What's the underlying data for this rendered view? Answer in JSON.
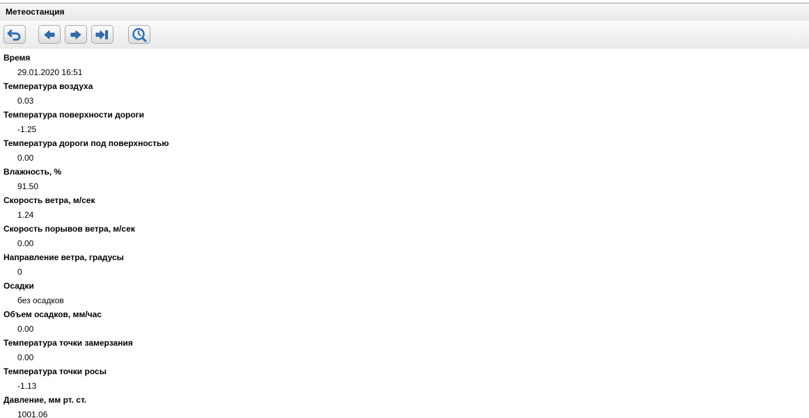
{
  "window": {
    "title": "Метеостанция"
  },
  "toolbar": {
    "buttons": [
      {
        "name": "undo",
        "icon": "undo-arrow-icon"
      },
      {
        "name": "previous",
        "icon": "arrow-left-icon"
      },
      {
        "name": "next",
        "icon": "arrow-right-icon"
      },
      {
        "name": "last",
        "icon": "arrow-to-end-icon"
      },
      {
        "name": "history",
        "icon": "clock-magnifier-icon"
      }
    ],
    "icon_color": "#2f6eb5"
  },
  "fields": [
    {
      "label": "Время",
      "value": "29.01.2020 16:51"
    },
    {
      "label": "Температура воздуха",
      "value": "0.03"
    },
    {
      "label": "Температура поверхности дороги",
      "value": "-1.25"
    },
    {
      "label": "Температура дороги под поверхностью",
      "value": "0.00"
    },
    {
      "label": "Влажность, %",
      "value": "91.50"
    },
    {
      "label": "Скорость ветра, м/сек",
      "value": "1.24"
    },
    {
      "label": "Скорость порывов ветра, м/сек",
      "value": "0.00"
    },
    {
      "label": "Направление ветра, градусы",
      "value": "0"
    },
    {
      "label": "Осадки",
      "value": "без осадков"
    },
    {
      "label": "Объем осадков, мм/час",
      "value": "0.00"
    },
    {
      "label": "Температура точки замерзания",
      "value": "0.00"
    },
    {
      "label": "Температура точки росы",
      "value": "-1.13"
    },
    {
      "label": "Давление, мм рт. ст.",
      "value": "1001.06"
    }
  ]
}
